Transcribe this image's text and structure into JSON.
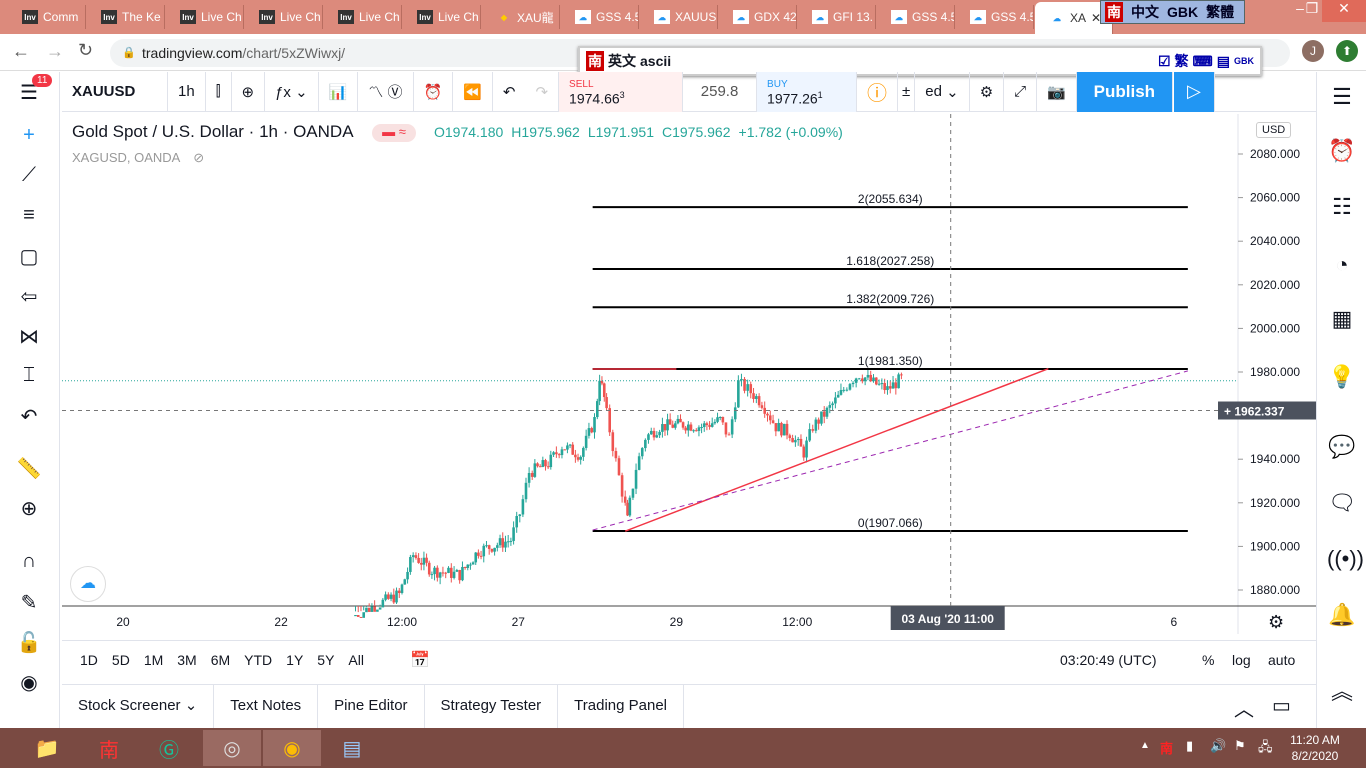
{
  "browser": {
    "tabs": [
      {
        "label": "Comm",
        "icon": "Inv"
      },
      {
        "label": "The Ke",
        "icon": "Inv"
      },
      {
        "label": "Live Ch",
        "icon": "Inv"
      },
      {
        "label": "Live Ch",
        "icon": "Inv"
      },
      {
        "label": "Live Ch",
        "icon": "Inv"
      },
      {
        "label": "Live Ch",
        "icon": "Inv"
      },
      {
        "label": "XAU龍",
        "icon": "gem"
      },
      {
        "label": "GSS 4.5",
        "icon": "tv"
      },
      {
        "label": "XAUUS",
        "icon": "tv"
      },
      {
        "label": "GDX 42",
        "icon": "tv"
      },
      {
        "label": "GFI 13.",
        "icon": "tv"
      },
      {
        "label": "GSS 4.5",
        "icon": "tv"
      },
      {
        "label": "GSS 4.5",
        "icon": "tv"
      },
      {
        "label": "XA",
        "icon": "tv"
      }
    ],
    "url_domain": "tradingview.com",
    "url_path": "/chart/5xZWiwxj/",
    "avatar": "J"
  },
  "ime": {
    "logo": "南",
    "lang": "中文",
    "encoding": "GBK",
    "trad": "繁體",
    "bar_mode": "英文",
    "bar_ascii": "ascii",
    "bar_trad": "繁",
    "bar_gbk": "GBK"
  },
  "toolbar": {
    "symbol": "XAUUSD",
    "interval": "1h",
    "sell_label": "SELL",
    "sell_price": "1974.66",
    "sell_sup": "3",
    "spread": "259.8",
    "buy_label": "BUY",
    "buy_price": "1977.26",
    "buy_sup": "1",
    "layout_partial": "ed",
    "publish": "Publish",
    "notification_badge": "11"
  },
  "legend": {
    "title": "Gold Spot / U.S. Dollar · 1h · OANDA",
    "open": "O1974.180",
    "high": "H1975.962",
    "low": "L1971.951",
    "close": "C1975.962",
    "change": "+1.782 (+0.09%)",
    "compare": "XAGUSD, OANDA"
  },
  "chart_data": {
    "type": "candlestick",
    "currency": "USD",
    "ylim": [
      1870,
      2092
    ],
    "y_ticks": [
      2080,
      2060,
      2040,
      2020,
      2000,
      1980,
      1960,
      1940,
      1920,
      1900,
      1880
    ],
    "y_tick_labels": [
      "2080.000",
      "2060.000",
      "2040.000",
      "2020.000",
      "2000.000",
      "1980.000",
      "1960.000",
      "1940.000",
      "1920.000",
      "1900.000",
      "1880.000"
    ],
    "x_ticks": [
      {
        "label": "20",
        "t": 0
      },
      {
        "label": "22",
        "t": 34
      },
      {
        "label": "12:00",
        "t": 60
      },
      {
        "label": "27",
        "t": 85
      },
      {
        "label": "29",
        "t": 119
      },
      {
        "label": "12:00",
        "t": 145
      },
      {
        "label": "6",
        "t": 226
      }
    ],
    "crosshair": {
      "price_label": "1962.337",
      "price": 1962.337,
      "time_label": "03 Aug '20   11:00",
      "t": 178
    },
    "last_price": 1975.962,
    "price_waypoints": [
      [
        50,
        1868
      ],
      [
        60,
        1878
      ],
      [
        63,
        1896
      ],
      [
        67,
        1889
      ],
      [
        73,
        1887
      ],
      [
        77,
        1898
      ],
      [
        84,
        1903
      ],
      [
        86,
        1915
      ],
      [
        88,
        1934
      ],
      [
        92,
        1938
      ],
      [
        95,
        1946
      ],
      [
        99,
        1942
      ],
      [
        102,
        1958
      ],
      [
        103,
        1978
      ],
      [
        104,
        1968
      ],
      [
        106,
        1946
      ],
      [
        108,
        1925
      ],
      [
        109,
        1912
      ],
      [
        111,
        1936
      ],
      [
        113,
        1950
      ],
      [
        116,
        1955
      ],
      [
        121,
        1956
      ],
      [
        125,
        1955
      ],
      [
        129,
        1958
      ],
      [
        131,
        1950
      ],
      [
        133,
        1975
      ],
      [
        135,
        1972
      ],
      [
        138,
        1966
      ],
      [
        141,
        1955
      ],
      [
        144,
        1952
      ],
      [
        147,
        1943
      ],
      [
        149,
        1955
      ],
      [
        152,
        1962
      ],
      [
        155,
        1970
      ],
      [
        157,
        1976
      ],
      [
        159,
        1979
      ],
      [
        162,
        1975
      ],
      [
        165,
        1972
      ],
      [
        168,
        1977
      ]
    ],
    "fib_levels": [
      {
        "label": "2(2055.634)",
        "price": 2055.634
      },
      {
        "label": "1.618(2027.258)",
        "price": 2027.258
      },
      {
        "label": "1.382(2009.726)",
        "price": 2009.726
      },
      {
        "label": "1(1981.350)",
        "price": 1981.35
      },
      {
        "label": "0(1907.066)",
        "price": 1907.066
      }
    ],
    "fib_t_range": [
      101,
      229
    ],
    "trend_line": {
      "from": [
        108,
        1907
      ],
      "to": [
        199,
        1981.5
      ],
      "color": "#f23645"
    },
    "parallel_line": {
      "from": [
        101,
        1907.5
      ],
      "to": [
        229,
        1980.5
      ],
      "color": "#9c27b0"
    }
  },
  "bottom": {
    "ranges": [
      "1D",
      "5D",
      "1M",
      "3M",
      "6M",
      "YTD",
      "1Y",
      "5Y",
      "All"
    ],
    "clock": "03:20:49 (UTC)",
    "pct": "%",
    "log": "log",
    "auto": "auto"
  },
  "panels": [
    "Stock Screener",
    "Text Notes",
    "Pine Editor",
    "Strategy Tester",
    "Trading Panel"
  ],
  "taskbar": {
    "time": "11:20 AM",
    "date": "8/2/2020"
  }
}
